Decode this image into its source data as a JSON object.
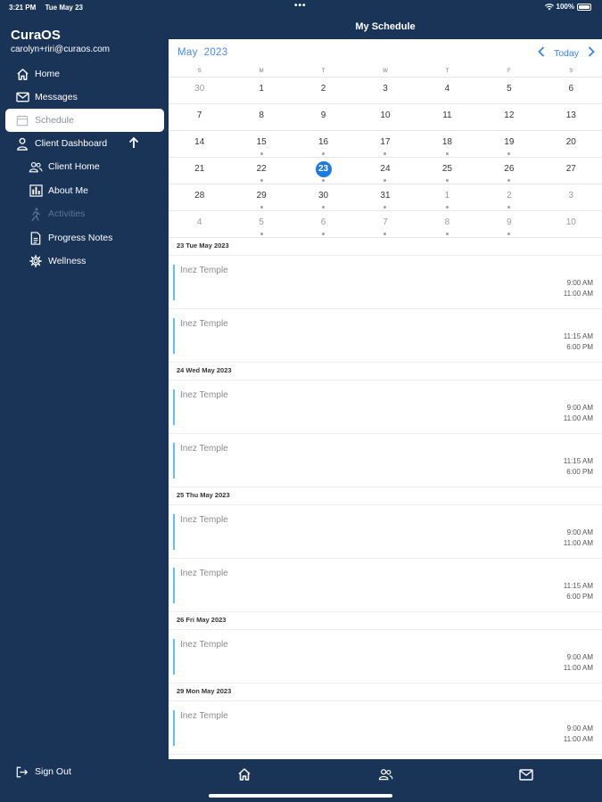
{
  "status": {
    "time": "3:21 PM",
    "date": "Tue May 23",
    "dots": "•••",
    "battery": "100%"
  },
  "app": {
    "name": "CuraOS",
    "email": "carolyn+riri@curaos.com"
  },
  "nav": {
    "home": "Home",
    "messages": "Messages",
    "schedule": "Schedule",
    "client_dashboard": "Client Dashboard",
    "client_home": "Client Home",
    "about_me": "About Me",
    "activities": "Activities",
    "progress_notes": "Progress Notes",
    "wellness": "Wellness",
    "sign_out": "Sign Out"
  },
  "header": {
    "title": "My Schedule"
  },
  "calendar": {
    "month": "May",
    "year": "2023",
    "today_label": "Today",
    "weekdays": [
      "S",
      "M",
      "T",
      "W",
      "T",
      "F",
      "S"
    ],
    "days": [
      {
        "d": "30",
        "m": true,
        "dot": false
      },
      {
        "d": "1",
        "m": false,
        "dot": false
      },
      {
        "d": "2",
        "m": false,
        "dot": false
      },
      {
        "d": "3",
        "m": false,
        "dot": false
      },
      {
        "d": "4",
        "m": false,
        "dot": false
      },
      {
        "d": "5",
        "m": false,
        "dot": false
      },
      {
        "d": "6",
        "m": false,
        "dot": false
      },
      {
        "d": "7",
        "m": false,
        "dot": false
      },
      {
        "d": "8",
        "m": false,
        "dot": false
      },
      {
        "d": "9",
        "m": false,
        "dot": false
      },
      {
        "d": "10",
        "m": false,
        "dot": false
      },
      {
        "d": "11",
        "m": false,
        "dot": false
      },
      {
        "d": "12",
        "m": false,
        "dot": false
      },
      {
        "d": "13",
        "m": false,
        "dot": false
      },
      {
        "d": "14",
        "m": false,
        "dot": false
      },
      {
        "d": "15",
        "m": false,
        "dot": true
      },
      {
        "d": "16",
        "m": false,
        "dot": true
      },
      {
        "d": "17",
        "m": false,
        "dot": true
      },
      {
        "d": "18",
        "m": false,
        "dot": true
      },
      {
        "d": "19",
        "m": false,
        "dot": true
      },
      {
        "d": "20",
        "m": false,
        "dot": false
      },
      {
        "d": "21",
        "m": false,
        "dot": false
      },
      {
        "d": "22",
        "m": false,
        "dot": true
      },
      {
        "d": "23",
        "m": false,
        "dot": true,
        "sel": true
      },
      {
        "d": "24",
        "m": false,
        "dot": true
      },
      {
        "d": "25",
        "m": false,
        "dot": true
      },
      {
        "d": "26",
        "m": false,
        "dot": true
      },
      {
        "d": "27",
        "m": false,
        "dot": false
      },
      {
        "d": "28",
        "m": false,
        "dot": false
      },
      {
        "d": "29",
        "m": false,
        "dot": true
      },
      {
        "d": "30",
        "m": false,
        "dot": true
      },
      {
        "d": "31",
        "m": false,
        "dot": true
      },
      {
        "d": "1",
        "m": true,
        "dot": true
      },
      {
        "d": "2",
        "m": true,
        "dot": true
      },
      {
        "d": "3",
        "m": true,
        "dot": false
      },
      {
        "d": "4",
        "m": true,
        "dot": false
      },
      {
        "d": "5",
        "m": true,
        "dot": true
      },
      {
        "d": "6",
        "m": true,
        "dot": true
      },
      {
        "d": "7",
        "m": true,
        "dot": true
      },
      {
        "d": "8",
        "m": true,
        "dot": true
      },
      {
        "d": "9",
        "m": true,
        "dot": true
      },
      {
        "d": "10",
        "m": true,
        "dot": false
      }
    ]
  },
  "agenda": [
    {
      "day": "23 Tue May 2023",
      "events": [
        {
          "title": "Inez Temple",
          "start": "9:00 AM",
          "end": "11:00 AM"
        },
        {
          "title": "Inez Temple",
          "start": "11:15 AM",
          "end": "6:00 PM"
        }
      ]
    },
    {
      "day": "24 Wed May 2023",
      "events": [
        {
          "title": "Inez Temple",
          "start": "9:00 AM",
          "end": "11:00 AM"
        },
        {
          "title": "Inez Temple",
          "start": "11:15 AM",
          "end": "6:00 PM"
        }
      ]
    },
    {
      "day": "25 Thu May 2023",
      "events": [
        {
          "title": "Inez Temple",
          "start": "9:00 AM",
          "end": "11:00 AM"
        },
        {
          "title": "Inez Temple",
          "start": "11:15 AM",
          "end": "6:00 PM"
        }
      ]
    },
    {
      "day": "26 Fri May 2023",
      "events": [
        {
          "title": "Inez Temple",
          "start": "9:00 AM",
          "end": "11:00 AM"
        }
      ]
    },
    {
      "day": "29 Mon May 2023",
      "events": [
        {
          "title": "Inez Temple",
          "start": "9:00 AM",
          "end": "11:00 AM"
        }
      ]
    }
  ],
  "colors": {
    "sidebar_bg": "#1a3457",
    "accent": "#1f7ae0",
    "event_bar": "#5cc3ea"
  },
  "icons": [
    "home-icon",
    "envelope-icon",
    "calendar-icon",
    "person-icon",
    "people-icon",
    "bar-chart-icon",
    "running-icon",
    "document-icon",
    "gear-icon",
    "sign-out-icon",
    "chevron-left-icon",
    "chevron-right-icon",
    "arrow-up-icon"
  ]
}
